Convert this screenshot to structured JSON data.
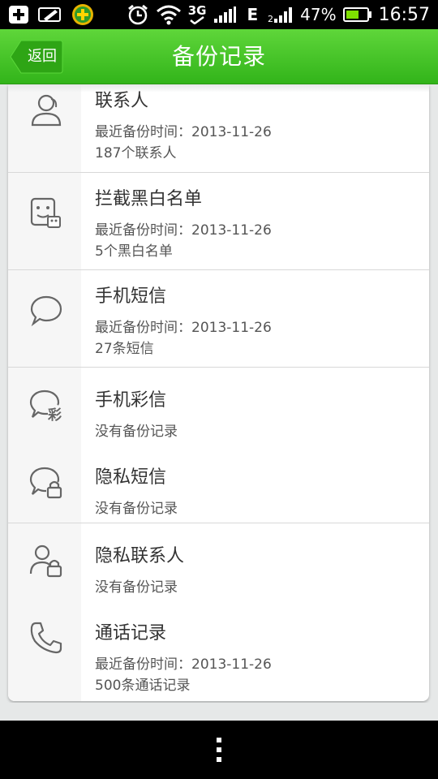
{
  "status_bar": {
    "battery_percent": "47%",
    "time": "16:57",
    "network_3g": "3G",
    "network_e": "E",
    "icons": [
      "plus-notification-icon",
      "edit-notification-icon",
      "app-notification-icon",
      "alarm-icon",
      "wifi-icon",
      "signal-icon",
      "signal-icon",
      "battery-icon"
    ]
  },
  "header": {
    "back_label": "返回",
    "title": "备份记录"
  },
  "items": [
    {
      "title": "联系人",
      "line1": "最近备份时间：2013-11-26",
      "line2": "187个联系人",
      "icon": "contacts-icon"
    },
    {
      "title": "拦截黑白名单",
      "line1": "最近备份时间：2013-11-26",
      "line2": "5个黑白名单",
      "icon": "block-list-icon"
    },
    {
      "title": "手机短信",
      "line1": "最近备份时间：2013-11-26",
      "line2": "27条短信",
      "icon": "sms-bubble-icon"
    },
    {
      "title": "手机彩信",
      "line1": "没有备份记录",
      "icon": "mms-bubble-icon",
      "icon_text": "彩"
    },
    {
      "title": "隐私短信",
      "line1": "没有备份记录",
      "icon": "private-sms-icon"
    },
    {
      "title": "隐私联系人",
      "line1": "没有备份记录",
      "icon": "private-contact-icon"
    },
    {
      "title": "通话记录",
      "line1": "最近备份时间：2013-11-26",
      "line2": "500条通话记录",
      "icon": "phone-icon"
    }
  ],
  "colors": {
    "header_green": "#3cbf22",
    "text_dark": "#333333",
    "text_sub": "#555555"
  }
}
